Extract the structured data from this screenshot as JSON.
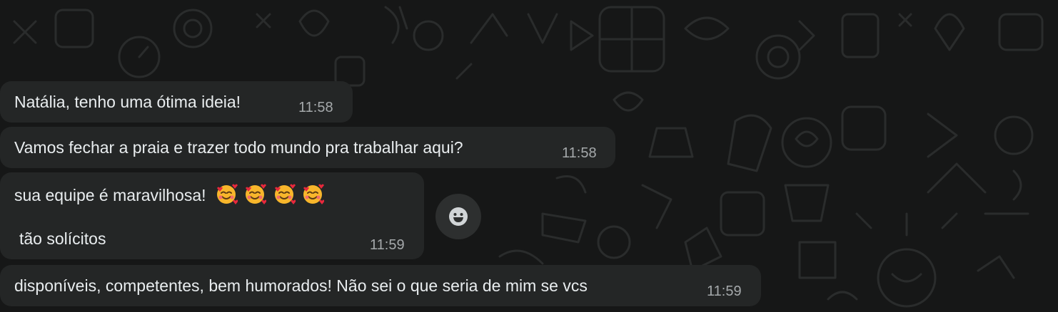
{
  "messages": [
    {
      "text": "Natália, tenho uma ótima ideia!",
      "time": "11:58"
    },
    {
      "text": "Vamos fechar a praia e trazer todo mundo pra trabalhar aqui?",
      "time": "11:58"
    },
    {
      "text": "sua equipe é maravilhosa!",
      "emoji_count": 4,
      "emoji_name": "smiling-face-with-hearts",
      "line2": "tão solícitos",
      "time": "11:59"
    },
    {
      "text": "disponíveis, competentes, bem humorados! Não sei o que seria de mim se vcs",
      "time": "11:59"
    }
  ],
  "reaction_button": {
    "icon": "smiley-icon"
  },
  "colors": {
    "background": "#161717",
    "bubble": "#242626",
    "text": "#e9edef",
    "timestamp": "#a5a9ab"
  }
}
